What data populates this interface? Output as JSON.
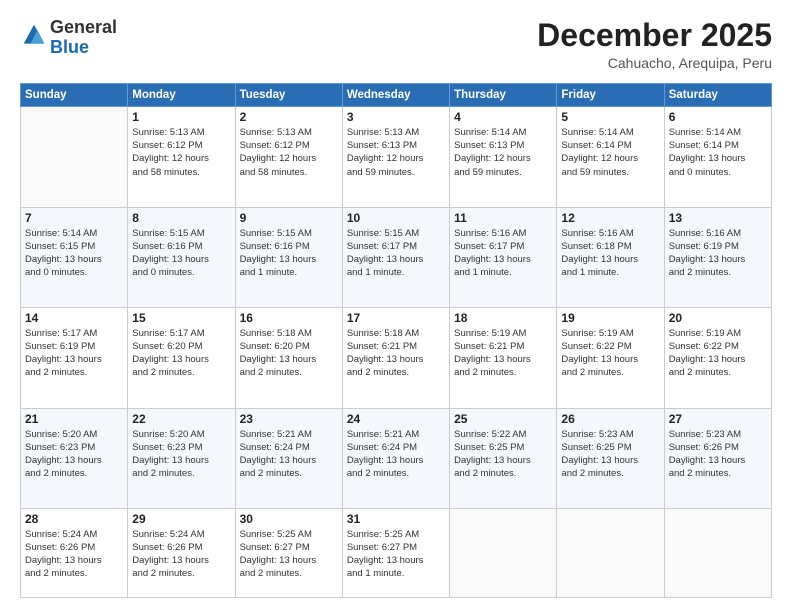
{
  "logo": {
    "general": "General",
    "blue": "Blue"
  },
  "title": "December 2025",
  "location": "Cahuacho, Arequipa, Peru",
  "days_of_week": [
    "Sunday",
    "Monday",
    "Tuesday",
    "Wednesday",
    "Thursday",
    "Friday",
    "Saturday"
  ],
  "weeks": [
    [
      {
        "num": "",
        "info": ""
      },
      {
        "num": "1",
        "info": "Sunrise: 5:13 AM\nSunset: 6:12 PM\nDaylight: 12 hours\nand 58 minutes."
      },
      {
        "num": "2",
        "info": "Sunrise: 5:13 AM\nSunset: 6:12 PM\nDaylight: 12 hours\nand 58 minutes."
      },
      {
        "num": "3",
        "info": "Sunrise: 5:13 AM\nSunset: 6:13 PM\nDaylight: 12 hours\nand 59 minutes."
      },
      {
        "num": "4",
        "info": "Sunrise: 5:14 AM\nSunset: 6:13 PM\nDaylight: 12 hours\nand 59 minutes."
      },
      {
        "num": "5",
        "info": "Sunrise: 5:14 AM\nSunset: 6:14 PM\nDaylight: 12 hours\nand 59 minutes."
      },
      {
        "num": "6",
        "info": "Sunrise: 5:14 AM\nSunset: 6:14 PM\nDaylight: 13 hours\nand 0 minutes."
      }
    ],
    [
      {
        "num": "7",
        "info": "Sunrise: 5:14 AM\nSunset: 6:15 PM\nDaylight: 13 hours\nand 0 minutes."
      },
      {
        "num": "8",
        "info": "Sunrise: 5:15 AM\nSunset: 6:16 PM\nDaylight: 13 hours\nand 0 minutes."
      },
      {
        "num": "9",
        "info": "Sunrise: 5:15 AM\nSunset: 6:16 PM\nDaylight: 13 hours\nand 1 minute."
      },
      {
        "num": "10",
        "info": "Sunrise: 5:15 AM\nSunset: 6:17 PM\nDaylight: 13 hours\nand 1 minute."
      },
      {
        "num": "11",
        "info": "Sunrise: 5:16 AM\nSunset: 6:17 PM\nDaylight: 13 hours\nand 1 minute."
      },
      {
        "num": "12",
        "info": "Sunrise: 5:16 AM\nSunset: 6:18 PM\nDaylight: 13 hours\nand 1 minute."
      },
      {
        "num": "13",
        "info": "Sunrise: 5:16 AM\nSunset: 6:19 PM\nDaylight: 13 hours\nand 2 minutes."
      }
    ],
    [
      {
        "num": "14",
        "info": "Sunrise: 5:17 AM\nSunset: 6:19 PM\nDaylight: 13 hours\nand 2 minutes."
      },
      {
        "num": "15",
        "info": "Sunrise: 5:17 AM\nSunset: 6:20 PM\nDaylight: 13 hours\nand 2 minutes."
      },
      {
        "num": "16",
        "info": "Sunrise: 5:18 AM\nSunset: 6:20 PM\nDaylight: 13 hours\nand 2 minutes."
      },
      {
        "num": "17",
        "info": "Sunrise: 5:18 AM\nSunset: 6:21 PM\nDaylight: 13 hours\nand 2 minutes."
      },
      {
        "num": "18",
        "info": "Sunrise: 5:19 AM\nSunset: 6:21 PM\nDaylight: 13 hours\nand 2 minutes."
      },
      {
        "num": "19",
        "info": "Sunrise: 5:19 AM\nSunset: 6:22 PM\nDaylight: 13 hours\nand 2 minutes."
      },
      {
        "num": "20",
        "info": "Sunrise: 5:19 AM\nSunset: 6:22 PM\nDaylight: 13 hours\nand 2 minutes."
      }
    ],
    [
      {
        "num": "21",
        "info": "Sunrise: 5:20 AM\nSunset: 6:23 PM\nDaylight: 13 hours\nand 2 minutes."
      },
      {
        "num": "22",
        "info": "Sunrise: 5:20 AM\nSunset: 6:23 PM\nDaylight: 13 hours\nand 2 minutes."
      },
      {
        "num": "23",
        "info": "Sunrise: 5:21 AM\nSunset: 6:24 PM\nDaylight: 13 hours\nand 2 minutes."
      },
      {
        "num": "24",
        "info": "Sunrise: 5:21 AM\nSunset: 6:24 PM\nDaylight: 13 hours\nand 2 minutes."
      },
      {
        "num": "25",
        "info": "Sunrise: 5:22 AM\nSunset: 6:25 PM\nDaylight: 13 hours\nand 2 minutes."
      },
      {
        "num": "26",
        "info": "Sunrise: 5:23 AM\nSunset: 6:25 PM\nDaylight: 13 hours\nand 2 minutes."
      },
      {
        "num": "27",
        "info": "Sunrise: 5:23 AM\nSunset: 6:26 PM\nDaylight: 13 hours\nand 2 minutes."
      }
    ],
    [
      {
        "num": "28",
        "info": "Sunrise: 5:24 AM\nSunset: 6:26 PM\nDaylight: 13 hours\nand 2 minutes."
      },
      {
        "num": "29",
        "info": "Sunrise: 5:24 AM\nSunset: 6:26 PM\nDaylight: 13 hours\nand 2 minutes."
      },
      {
        "num": "30",
        "info": "Sunrise: 5:25 AM\nSunset: 6:27 PM\nDaylight: 13 hours\nand 2 minutes."
      },
      {
        "num": "31",
        "info": "Sunrise: 5:25 AM\nSunset: 6:27 PM\nDaylight: 13 hours\nand 1 minute."
      },
      {
        "num": "",
        "info": ""
      },
      {
        "num": "",
        "info": ""
      },
      {
        "num": "",
        "info": ""
      }
    ]
  ]
}
